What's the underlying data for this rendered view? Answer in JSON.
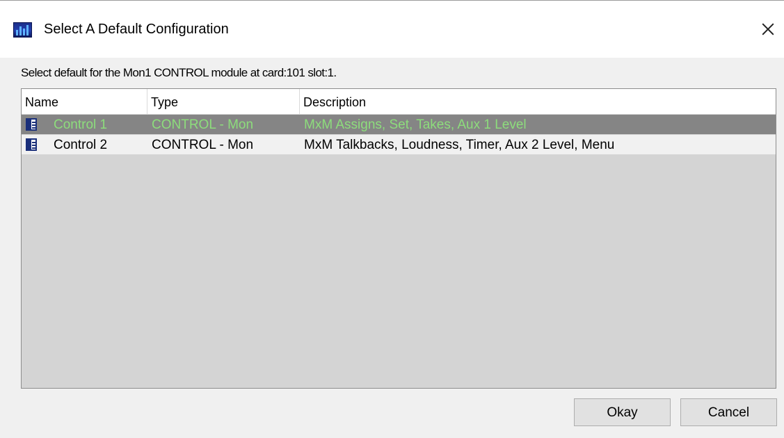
{
  "window": {
    "title": "Select A Default Configuration",
    "icon": "app-logo-icon",
    "close_icon": "close-icon"
  },
  "prompt": "Select default for the Mon1 CONTROL module at card:101 slot:1.",
  "table": {
    "columns": [
      "Name",
      "Type",
      "Description"
    ],
    "rows": [
      {
        "icon": "document-icon",
        "name": "Control 1",
        "type": "CONTROL - Mon",
        "description": "MxM Assigns, Set, Takes, Aux 1 Level",
        "selected": true
      },
      {
        "icon": "document-icon",
        "name": "Control 2",
        "type": "CONTROL - Mon",
        "description": "MxM Talkbacks, Loudness, Timer, Aux 2 Level, Menu",
        "selected": false
      }
    ]
  },
  "buttons": {
    "okay": "Okay",
    "cancel": "Cancel"
  },
  "colors": {
    "selected_row_bg": "#858585",
    "selected_row_text": "#8ddd7c",
    "list_bg": "#d4d4d4"
  }
}
